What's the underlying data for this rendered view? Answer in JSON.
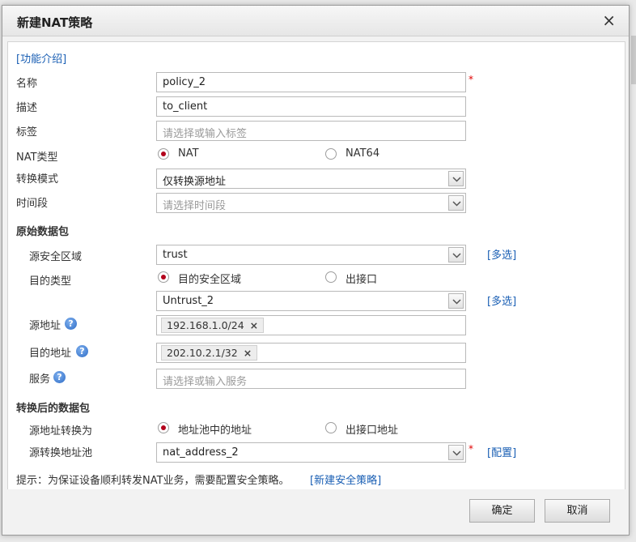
{
  "dialog": {
    "title": "新建NAT策略",
    "close_glyph": "×"
  },
  "intro_link": "[功能介绍]",
  "form": {
    "name_label": "名称",
    "name_value": "policy_2",
    "required_mark": "*",
    "desc_label": "描述",
    "desc_value": "to_client",
    "tag_label": "标签",
    "tag_placeholder": "请选择或输入标签",
    "nat_type_label": "NAT类型",
    "nat_type_options": [
      "NAT",
      "NAT64"
    ],
    "nat_type_selected": "NAT",
    "mode_label": "转换模式",
    "mode_value": "仅转换源地址",
    "time_label": "时间段",
    "time_placeholder": "请选择时间段"
  },
  "original": {
    "section_title": "原始数据包",
    "src_zone_label": "源安全区域",
    "src_zone_value": "trust",
    "multi_link": "[多选]",
    "dst_type_label": "目的类型",
    "dst_type_options": [
      "目的安全区域",
      "出接口"
    ],
    "dst_type_selected": "目的安全区域",
    "dst_zone_value": "Untrust_2",
    "src_addr_label": "源地址",
    "src_addr_tag": "192.168.1.0/24",
    "dst_addr_label": "目的地址",
    "dst_addr_tag": "202.10.2.1/32",
    "service_label": "服务",
    "service_placeholder": "请选择或输入服务",
    "help_glyph": "?",
    "tag_remove_glyph": "×"
  },
  "translated": {
    "section_title": "转换后的数据包",
    "src_trans_label": "源地址转换为",
    "src_trans_options": [
      "地址池中的地址",
      "出接口地址"
    ],
    "src_trans_selected": "地址池中的地址",
    "pool_label": "源转换地址池",
    "pool_value": "nat_address_2",
    "config_link": "[配置]"
  },
  "hint": {
    "text": "提示：为保证设备顺利转发NAT业务，需要配置安全策略。",
    "link": "[新建安全策略]"
  },
  "buttons": {
    "ok": "确定",
    "cancel": "取消"
  },
  "colors": {
    "link": "#1a5fb4",
    "required": "#e00000",
    "radio_selected": "#b3001b"
  }
}
